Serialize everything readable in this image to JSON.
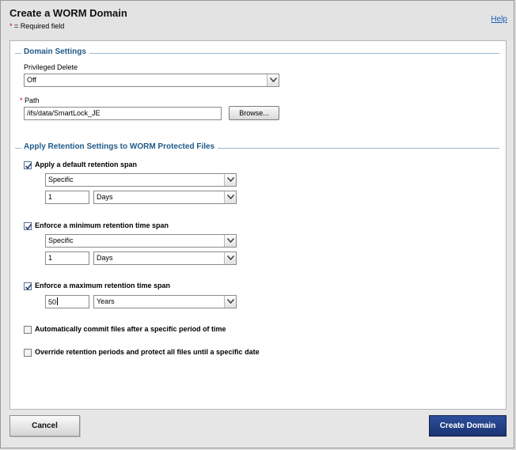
{
  "dialog": {
    "title": "Create a WORM Domain",
    "required_star": "*",
    "required_note": " = Required field",
    "help_label": "Help"
  },
  "domain_settings": {
    "heading": "Domain Settings",
    "privileged_delete_label": "Privileged Delete",
    "privileged_delete_value": "Off",
    "path_star": "*",
    "path_label": "Path",
    "path_value": "/ifs/data/SmartLock_JE",
    "browse_label": "Browse..."
  },
  "retention": {
    "heading": "Apply Retention Settings to WORM Protected Files",
    "default_span": {
      "checked": true,
      "label": "Apply a default retention span",
      "mode": "Specific",
      "amount": "1",
      "unit": "Days"
    },
    "minimum_span": {
      "checked": true,
      "label": "Enforce a minimum retention time span",
      "mode": "Specific",
      "amount": "1",
      "unit": "Days"
    },
    "maximum_span": {
      "checked": true,
      "label": "Enforce a maximum retention time span",
      "amount": "50",
      "unit": "Years"
    },
    "autocommit": {
      "checked": false,
      "label": "Automatically commit files after a specific period of time"
    },
    "override": {
      "checked": false,
      "label": "Override retention periods and protect all files until a specific date"
    }
  },
  "footer": {
    "cancel_label": "Cancel",
    "create_label": "Create Domain"
  },
  "colors": {
    "section_heading": "#1f5a8a",
    "primary_button": "#1b3372",
    "required_star": "#d00000",
    "link": "#1a5fb4"
  }
}
